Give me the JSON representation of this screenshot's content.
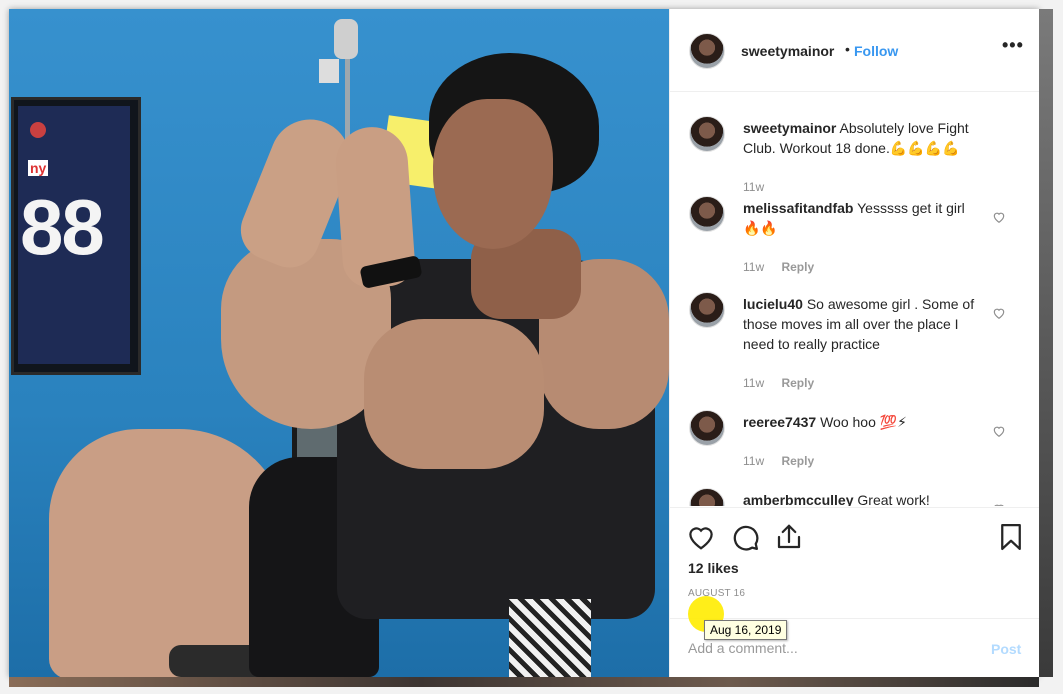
{
  "post": {
    "username": "sweetymainor",
    "dot": "•",
    "follow_label": "Follow",
    "more_label": "•••"
  },
  "comments": [
    {
      "user": "sweetymainor",
      "text": "Absolutely love Fight Club. Workout 18 done.",
      "emoji": "💪💪💪💪",
      "time": "11w",
      "reply": ""
    },
    {
      "user": "melissafitandfab",
      "text": "Yesssss get it girl",
      "emoji": "🔥🔥",
      "time": "11w",
      "reply": "Reply"
    },
    {
      "user": "lucielu40",
      "text": "So awesome girl . Some of those moves im all over the place I need to really practice",
      "emoji": "",
      "time": "11w",
      "reply": "Reply"
    },
    {
      "user": "reeree7437",
      "text": "Woo hoo",
      "emoji": "💯⚡",
      "time": "11w",
      "reply": "Reply"
    },
    {
      "user": "amberbmcculley",
      "text": "Great work!",
      "emoji": "",
      "time": "",
      "reply": ""
    }
  ],
  "actions": {
    "likes": "12 likes",
    "date": "AUGUST 16",
    "icons": [
      "heart-icon",
      "comment-icon",
      "share-icon",
      "bookmark-icon"
    ]
  },
  "add_comment": {
    "placeholder": "Add a comment...",
    "post_label": "Post"
  },
  "tooltip": {
    "text": "Aug 16, 2019"
  },
  "colors": {
    "accent": "#3897f0",
    "post_disabled": "#b3dbff",
    "highlight": "#ffec00"
  }
}
